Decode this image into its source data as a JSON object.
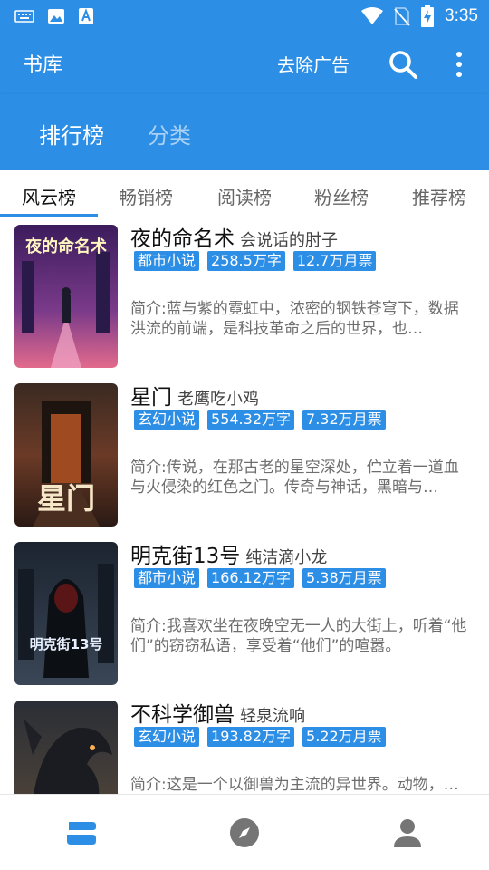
{
  "status": {
    "time": "3:35"
  },
  "appbar": {
    "title": "书库",
    "remove_ads": "去除广告"
  },
  "top_tabs": [
    "排行榜",
    "分类"
  ],
  "sub_tabs": [
    "风云榜",
    "畅销榜",
    "阅读榜",
    "粉丝榜",
    "推荐榜"
  ],
  "books": [
    {
      "title": "夜的命名术",
      "author": "会说话的肘子",
      "tags": [
        "都市小说",
        "258.5万字",
        "12.7万月票"
      ],
      "desc": "简介:蓝与紫的霓虹中，浓密的钢铁苍穹下，数据洪流的前端，是科技革命之后的世界，也…",
      "cover_text": "夜的命名术"
    },
    {
      "title": "星门",
      "author": "老鹰吃小鸡",
      "tags": [
        "玄幻小说",
        "554.32万字",
        "7.32万月票"
      ],
      "desc": "简介:传说，在那古老的星空深处，伫立着一道血与火侵染的红色之门。传奇与神话，黑暗与…",
      "cover_text": "星门"
    },
    {
      "title": "明克街13号",
      "author": "纯洁滴小龙",
      "tags": [
        "都市小说",
        "166.12万字",
        "5.38万月票"
      ],
      "desc": "简介:我喜欢坐在夜晚空无一人的大街上，听着“他们”的窃窃私语，享受着“他们”的喧嚣。",
      "cover_text": "明克街13号"
    },
    {
      "title": "不科学御兽",
      "author": "轻泉流响",
      "tags": [
        "玄幻小说",
        "193.82万字",
        "5.22万月票"
      ],
      "desc": "简介:这是一个以御兽为主流的异世界。动物，…",
      "cover_text": ""
    }
  ],
  "colors": {
    "primary": "#2d8ee6",
    "tag_bg": "#2d8ee6"
  },
  "bottom_nav": [
    "bookshelf-icon",
    "explore-compass-icon",
    "profile-person-icon"
  ]
}
